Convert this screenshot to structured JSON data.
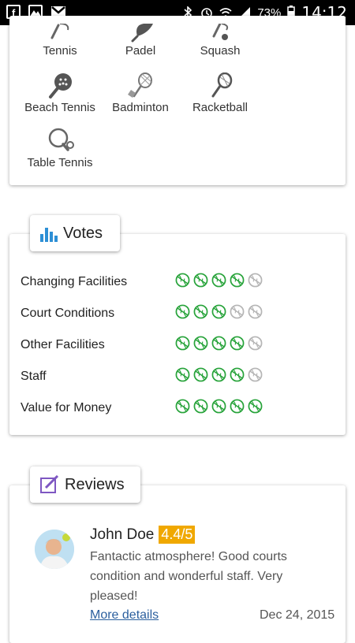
{
  "status_bar": {
    "battery": "73%",
    "time": "14:12",
    "left_icons": [
      "facebook-icon",
      "gallery-icon",
      "gmail-icon"
    ],
    "right_icons": [
      "bluetooth-icon",
      "alarm-icon",
      "wifi-icon",
      "signal-icon",
      "battery-icon"
    ]
  },
  "sports": [
    {
      "label": "Tennis",
      "icon": "tennis-racket-icon"
    },
    {
      "label": "Padel",
      "icon": "padel-racket-icon"
    },
    {
      "label": "Squash",
      "icon": "squash-racket-icon"
    },
    {
      "label": "Beach Tennis",
      "icon": "beach-tennis-racket-icon"
    },
    {
      "label": "Badminton",
      "icon": "badminton-racket-icon"
    },
    {
      "label": "Racketball",
      "icon": "racketball-racket-icon"
    },
    {
      "label": "Table Tennis",
      "icon": "table-tennis-paddle-icon"
    }
  ],
  "votes": {
    "title": "Votes",
    "icon": "bar-chart-icon",
    "max": 5,
    "items": [
      {
        "label": "Changing Facilities",
        "score": 4
      },
      {
        "label": "Court Conditions",
        "score": 3
      },
      {
        "label": "Other Facilities",
        "score": 4
      },
      {
        "label": "Staff",
        "score": 4
      },
      {
        "label": "Value for Money",
        "score": 5
      }
    ]
  },
  "reviews": {
    "title": "Reviews",
    "icon": "edit-icon",
    "items": [
      {
        "name": "John Doe",
        "score": "4.4/5",
        "text": "Fantactic atmosphere! Good courts condition and wonderful staff. Very pleased!",
        "more": "More details",
        "date": "Dec 24, 2015"
      }
    ]
  },
  "colors": {
    "ball_on": "#27a33a",
    "ball_off": "#b5b5b5",
    "score_badge": "#f0a800",
    "link": "#2b5f9e",
    "votes_icon": "#2d8fd5",
    "reviews_icon": "#7e57c2"
  }
}
